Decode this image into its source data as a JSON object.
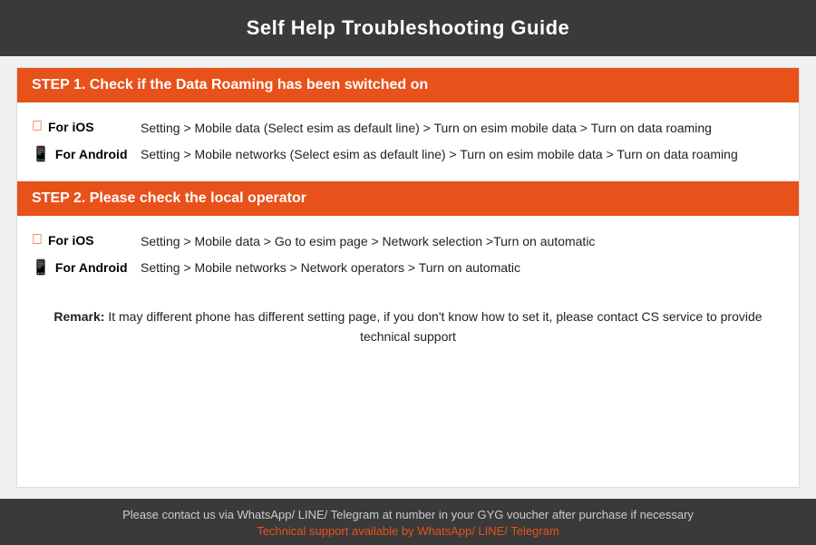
{
  "header": {
    "title": "Self Help Troubleshooting Guide"
  },
  "step1": {
    "heading": "STEP 1.  Check if the Data Roaming has been switched on",
    "ios_label": "For iOS",
    "ios_text": "Setting > Mobile data (Select esim as default line) > Turn on esim mobile data > Turn on data roaming",
    "android_label": "For Android",
    "android_text": "Setting > Mobile networks (Select esim as default line) > Turn on esim mobile data > Turn on data roaming"
  },
  "step2": {
    "heading": "STEP 2.  Please check the local operator",
    "ios_label": "For iOS",
    "ios_text": "Setting > Mobile data > Go to esim page > Network selection >Turn on automatic",
    "android_label": "For Android",
    "android_text": "Setting > Mobile networks > Network operators > Turn on automatic"
  },
  "remark": {
    "label": "Remark:",
    "text": "It may different phone has different setting page, if you don't know how to set it,  please contact CS service to provide technical support"
  },
  "footer": {
    "main_text": "Please contact us via WhatsApp/ LINE/ Telegram at number in your GYG voucher after purchase if necessary",
    "support_text": "Technical support available by WhatsApp/ LINE/ Telegram"
  }
}
